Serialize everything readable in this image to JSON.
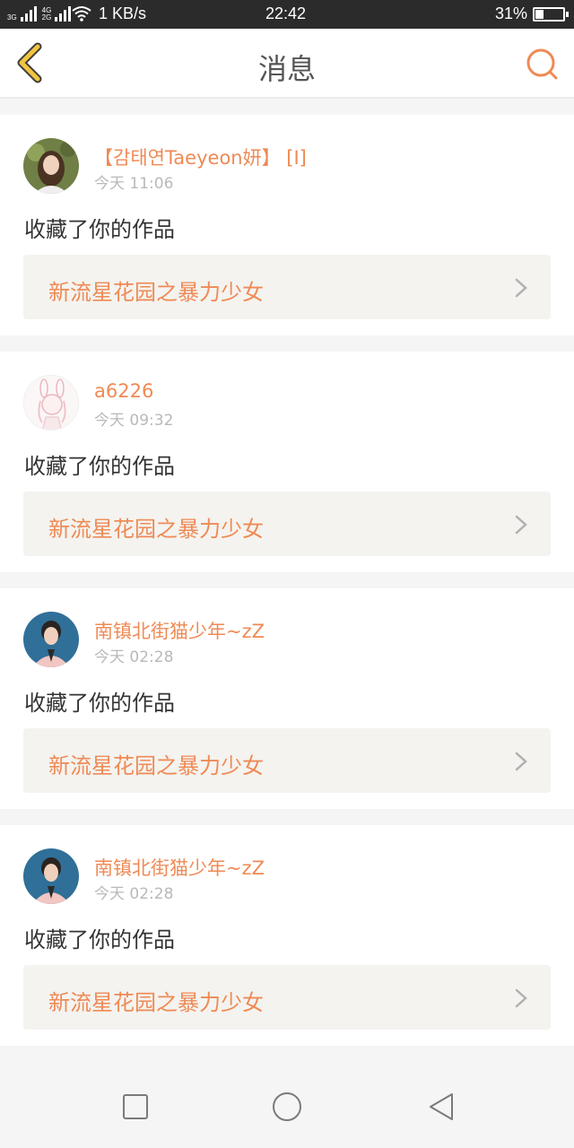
{
  "status_bar": {
    "sim1": "3G",
    "sim2_top": "4G",
    "sim2_bottom": "2G",
    "net_speed": "1 KB/s",
    "time": "22:42",
    "battery": "31%"
  },
  "header": {
    "title": "消息"
  },
  "colors": {
    "accent": "#ef8a55",
    "back_arrow": "#f2c440"
  },
  "messages": [
    {
      "name": "【감태연Taeyeon妍】 [I]",
      "time": "今天 11:06",
      "action": "收藏了你的作品",
      "work": "新流星花园之暴力少女"
    },
    {
      "name": "a6226",
      "time": "今天 09:32",
      "action": "收藏了你的作品",
      "work": "新流星花园之暴力少女"
    },
    {
      "name": "南镇北街猫少年~zZ",
      "time": "今天 02:28",
      "action": "收藏了你的作品",
      "work": "新流星花园之暴力少女"
    },
    {
      "name": "南镇北街猫少年~zZ",
      "time": "今天 02:28",
      "action": "收藏了你的作品",
      "work": "新流星花园之暴力少女"
    }
  ],
  "nav": {
    "icons": [
      "square-recent-icon",
      "circle-home-icon",
      "triangle-back-icon"
    ]
  }
}
